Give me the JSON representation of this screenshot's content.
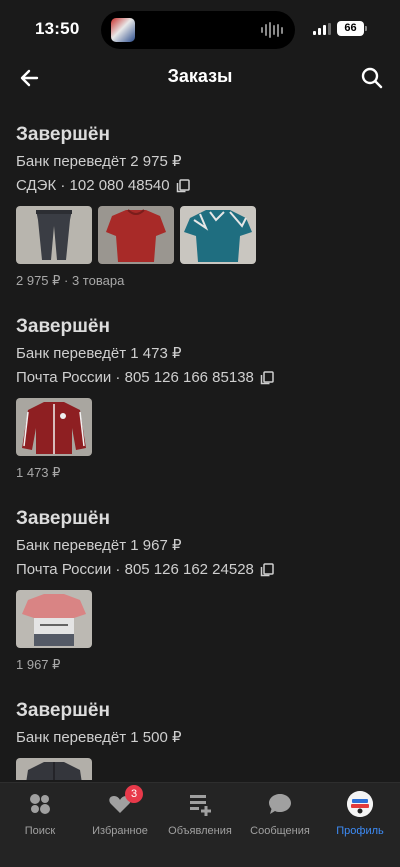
{
  "status_bar": {
    "time": "13:50",
    "battery": "66"
  },
  "header": {
    "title": "Заказы"
  },
  "orders": [
    {
      "status": "Завершён",
      "payout": "Банк переведёт 2 975 ₽",
      "delivery": "СДЭК · 102 080 48540",
      "summary": "2 975 ₽ · 3 товара",
      "items": [
        "dark-joggers",
        "red-tshirt",
        "teal-pattern-tshirt"
      ]
    },
    {
      "status": "Завершён",
      "payout": "Банк переведёт 1 473 ₽",
      "delivery": "Почта России · 805 126 166 85138",
      "summary": "1 473 ₽",
      "items": [
        "red-track-jacket"
      ]
    },
    {
      "status": "Завершён",
      "payout": "Банк переведёт 1 967 ₽",
      "delivery": "Почта России · 805 126 162 24528",
      "summary": "1 967 ₽",
      "items": [
        "pink-grey-tshirt"
      ]
    },
    {
      "status": "Завершён",
      "payout": "Банк переведёт 1 500 ₽",
      "delivery": "",
      "summary": "",
      "items": [
        "dark-zip-jacket"
      ]
    }
  ],
  "bottom_nav": {
    "items": [
      {
        "label": "Поиск",
        "icon": "search-circles-icon"
      },
      {
        "label": "Избранное",
        "icon": "heart-icon",
        "badge": "3"
      },
      {
        "label": "Объявления",
        "icon": "listings-add-icon"
      },
      {
        "label": "Сообщения",
        "icon": "chat-bubble-icon"
      },
      {
        "label": "Профиль",
        "icon": "profile-avatar",
        "active": true
      }
    ]
  },
  "colors": {
    "background": "#1a1a1a",
    "accent": "#3d8bf5",
    "badge": "#e8394a"
  }
}
